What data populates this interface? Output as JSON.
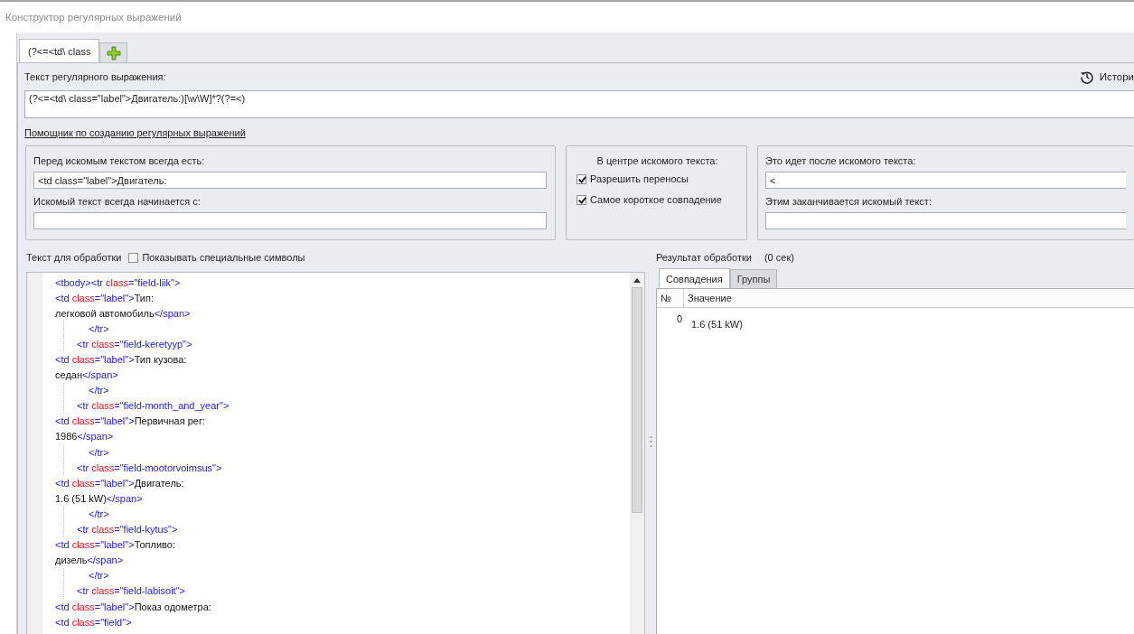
{
  "window": {
    "title": "Конструктор регулярных выражений"
  },
  "tabs": [
    {
      "label": "(?<=<td\\ class",
      "selected": true
    }
  ],
  "regex": {
    "label": "Текст регулярного выражения:",
    "history": "Истори",
    "value": "(?<=<td\\ class=\"label\">Двигатель:)[\\w\\W]*?(?=<)"
  },
  "helper_link": "Помощник по созданию регулярных выражений",
  "before": {
    "label": "Перед искомым текстом всегда есть:",
    "value": "<td class=\"label\">Двигатель:",
    "starts_label": "Искомый текст всегда начинается с:"
  },
  "center": {
    "title": "В центре искомого текста:",
    "options": [
      {
        "label": "Разрешить переносы",
        "checked": true
      },
      {
        "label": "Самое короткое совпадение",
        "checked": true
      }
    ]
  },
  "after": {
    "label": "Это идет после искомого текста:",
    "value": "<",
    "ends_label": "Этим заканчивается искомый текст:"
  },
  "source": {
    "label": "Текст для обработки",
    "special_chars": {
      "label": "Показывать специальные символы",
      "checked": false
    },
    "lines": [
      {
        "kind": "flush",
        "tokens": [
          {
            "kind": "tag",
            "text": "<tbody><tr "
          },
          {
            "kind": "attr",
            "text": "class"
          },
          {
            "kind": "tag",
            "text": "=\"field-liik\">"
          }
        ]
      },
      {
        "kind": "flush",
        "tokens": [
          {
            "kind": "tag",
            "text": "<td "
          },
          {
            "kind": "attr",
            "text": "class"
          },
          {
            "kind": "tag",
            "text": "=\"label\">"
          },
          {
            "kind": "text",
            "text": "Тип:"
          }
        ]
      },
      {
        "kind": "flush",
        "tokens": [
          {
            "kind": "text",
            "text": "легковой автомобиль"
          },
          {
            "kind": "tag",
            "text": "</span>"
          }
        ]
      },
      {
        "kind": "close",
        "tokens": [
          {
            "kind": "tag",
            "text": "</tr>"
          }
        ]
      },
      {
        "kind": "row",
        "tokens": [
          {
            "kind": "tag",
            "text": "<tr "
          },
          {
            "kind": "attr",
            "text": "class"
          },
          {
            "kind": "tag",
            "text": "=\"field-keretyyp\">"
          }
        ]
      },
      {
        "kind": "flush",
        "tokens": [
          {
            "kind": "tag",
            "text": "<td "
          },
          {
            "kind": "attr",
            "text": "class"
          },
          {
            "kind": "tag",
            "text": "=\"label\">"
          },
          {
            "kind": "text",
            "text": "Тип кузова:"
          }
        ]
      },
      {
        "kind": "flush",
        "tokens": [
          {
            "kind": "text",
            "text": "седан"
          },
          {
            "kind": "tag",
            "text": "</span>"
          }
        ]
      },
      {
        "kind": "close",
        "tokens": [
          {
            "kind": "tag",
            "text": "</tr>"
          }
        ]
      },
      {
        "kind": "row",
        "tokens": [
          {
            "kind": "tag",
            "text": "<tr "
          },
          {
            "kind": "attr",
            "text": "class"
          },
          {
            "kind": "tag",
            "text": "=\"field-month_and_year\">"
          }
        ]
      },
      {
        "kind": "flush",
        "tokens": [
          {
            "kind": "tag",
            "text": "<td "
          },
          {
            "kind": "attr",
            "text": "class"
          },
          {
            "kind": "tag",
            "text": "=\"label\">"
          },
          {
            "kind": "text",
            "text": "Первичная рег:"
          }
        ]
      },
      {
        "kind": "flush",
        "tokens": [
          {
            "kind": "text",
            "text": "1986"
          },
          {
            "kind": "tag",
            "text": "</span>"
          }
        ]
      },
      {
        "kind": "close",
        "tokens": [
          {
            "kind": "tag",
            "text": "</tr>"
          }
        ]
      },
      {
        "kind": "row",
        "tokens": [
          {
            "kind": "tag",
            "text": "<tr "
          },
          {
            "kind": "attr",
            "text": "class"
          },
          {
            "kind": "tag",
            "text": "=\"field-mootorvoimsus\">"
          }
        ]
      },
      {
        "kind": "flush",
        "tokens": [
          {
            "kind": "tag",
            "text": "<td "
          },
          {
            "kind": "attr",
            "text": "class"
          },
          {
            "kind": "tag",
            "text": "=\"label\">"
          },
          {
            "kind": "text",
            "text": "Двигатель:"
          }
        ]
      },
      {
        "kind": "flush",
        "tokens": [
          {
            "kind": "text",
            "text": "1.6 (51 kW)"
          },
          {
            "kind": "tag",
            "text": "</span>"
          }
        ]
      },
      {
        "kind": "close",
        "tokens": [
          {
            "kind": "tag",
            "text": "</tr>"
          }
        ]
      },
      {
        "kind": "row",
        "tokens": [
          {
            "kind": "tag",
            "text": "<tr "
          },
          {
            "kind": "attr",
            "text": "class"
          },
          {
            "kind": "tag",
            "text": "=\"field-kytus\">"
          }
        ]
      },
      {
        "kind": "flush",
        "tokens": [
          {
            "kind": "tag",
            "text": "<td "
          },
          {
            "kind": "attr",
            "text": "class"
          },
          {
            "kind": "tag",
            "text": "=\"label\">"
          },
          {
            "kind": "text",
            "text": "Топливо:"
          }
        ]
      },
      {
        "kind": "flush",
        "tokens": [
          {
            "kind": "text",
            "text": "дизель"
          },
          {
            "kind": "tag",
            "text": "</span>"
          }
        ]
      },
      {
        "kind": "close",
        "tokens": [
          {
            "kind": "tag",
            "text": "</tr>"
          }
        ]
      },
      {
        "kind": "row",
        "tokens": [
          {
            "kind": "tag",
            "text": "<tr "
          },
          {
            "kind": "attr",
            "text": "class"
          },
          {
            "kind": "tag",
            "text": "=\"field-labisoit\">"
          }
        ]
      },
      {
        "kind": "flush",
        "tokens": [
          {
            "kind": "tag",
            "text": "<td "
          },
          {
            "kind": "attr",
            "text": "class"
          },
          {
            "kind": "tag",
            "text": "=\"label\">"
          },
          {
            "kind": "text",
            "text": "Показ одометра:"
          }
        ]
      },
      {
        "kind": "flush",
        "tokens": [
          {
            "kind": "tag",
            "text": "<td "
          },
          {
            "kind": "attr",
            "text": "class"
          },
          {
            "kind": "tag",
            "text": "=\"field\">"
          }
        ]
      }
    ]
  },
  "result": {
    "label": "Результат обработки",
    "time": "(0 сек)",
    "tabs": [
      {
        "label": "Совпадения",
        "selected": true
      },
      {
        "label": "Группы",
        "selected": false
      }
    ],
    "table": {
      "columns": [
        "№",
        "Значение"
      ],
      "rows": [
        [
          "0",
          "1.6 (51 kW)"
        ]
      ]
    }
  }
}
